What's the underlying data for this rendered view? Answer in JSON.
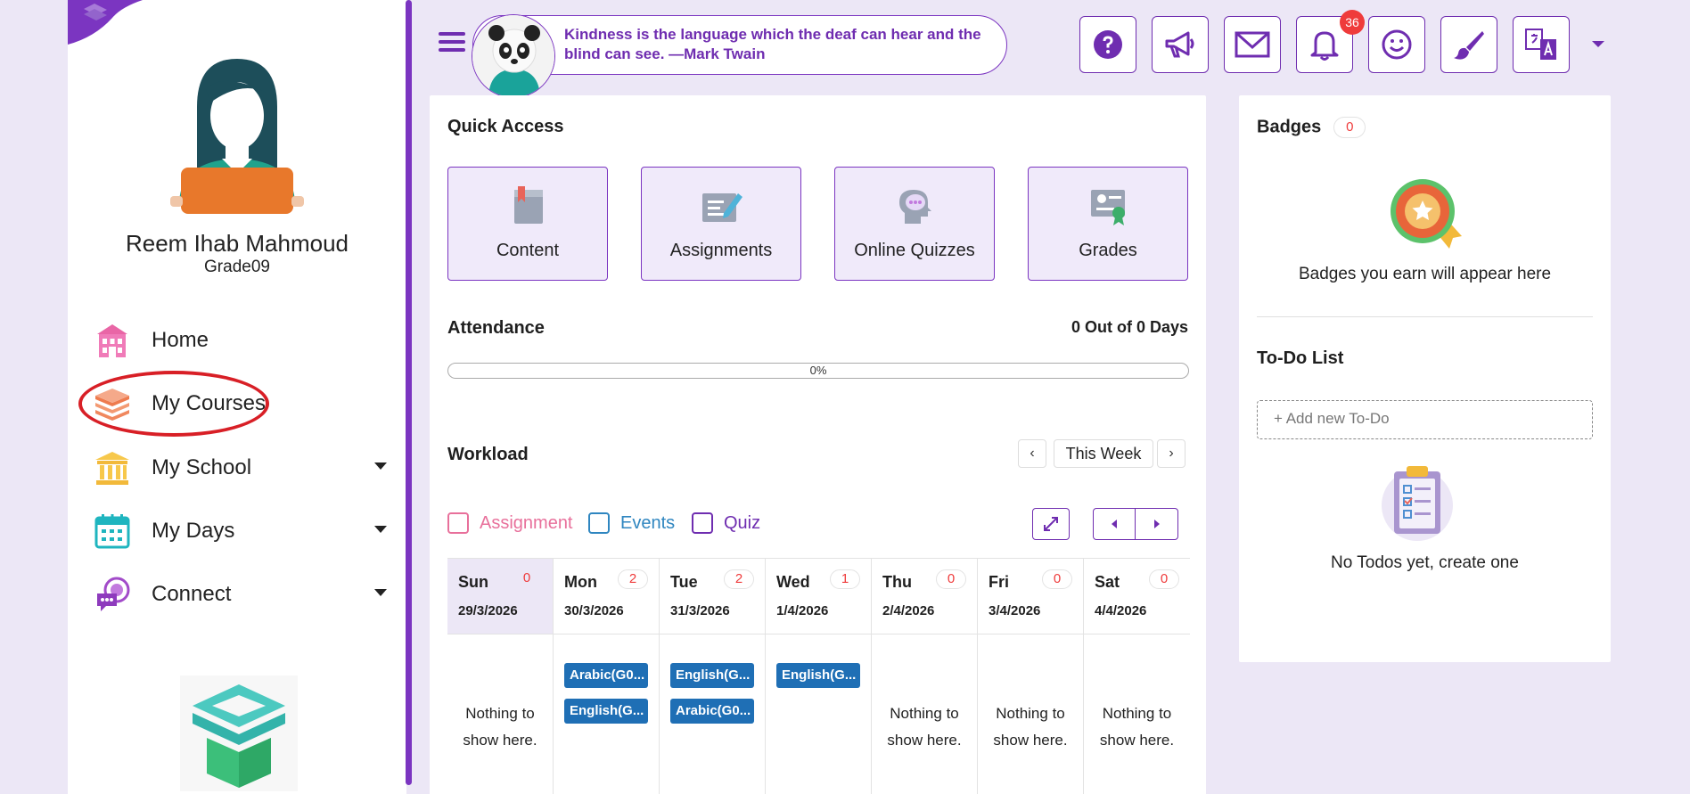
{
  "colors": {
    "primary": "#6f2db0",
    "badge_red": "#ef3b3b",
    "event_blue": "#1f6fb5",
    "legend_assignment": "#e8709b",
    "legend_events": "#2f86c0",
    "legend_quiz": "#6f2db0",
    "highlight": "#d81f26"
  },
  "user": {
    "name": "Reem Ihab Mahmoud",
    "grade": "Grade09"
  },
  "nav": [
    {
      "label": "Home",
      "icon": "school-building-icon",
      "has_dropdown": false
    },
    {
      "label": "My Courses",
      "icon": "books-icon",
      "has_dropdown": false,
      "highlighted": true
    },
    {
      "label": "My School",
      "icon": "institution-icon",
      "has_dropdown": true
    },
    {
      "label": "My Days",
      "icon": "calendar-icon",
      "has_dropdown": true
    },
    {
      "label": "Connect",
      "icon": "chat-bubbles-icon",
      "has_dropdown": true
    }
  ],
  "quote": {
    "text": "Kindness is the language which the deaf can hear and the blind can see. —Mark Twain"
  },
  "toolbar": {
    "buttons": [
      "help-icon",
      "megaphone-icon",
      "mail-icon",
      "bell-icon",
      "smiley-icon",
      "brush-icon",
      "translate-icon"
    ],
    "notification_count": "36"
  },
  "quick_access": {
    "title": "Quick Access",
    "items": [
      {
        "label": "Content",
        "icon": "book-icon"
      },
      {
        "label": "Assignments",
        "icon": "assignment-pen-icon"
      },
      {
        "label": "Online Quizzes",
        "icon": "quiz-head-icon"
      },
      {
        "label": "Grades",
        "icon": "certificate-icon"
      }
    ]
  },
  "attendance": {
    "title": "Attendance",
    "summary": "0 Out of 0 Days",
    "progress_percent": 0,
    "progress_text": "0%"
  },
  "workload": {
    "title": "Workload",
    "week_label": "This Week",
    "legend": [
      "Assignment",
      "Events",
      "Quiz"
    ],
    "days": [
      {
        "name": "Sun",
        "count": "0",
        "date": "29/3/2026",
        "events": [],
        "empty_line1": "Nothing to",
        "empty_line2": "show here."
      },
      {
        "name": "Mon",
        "count": "2",
        "date": "30/3/2026",
        "events": [
          "Arabic(G0...",
          "English(G..."
        ]
      },
      {
        "name": "Tue",
        "count": "2",
        "date": "31/3/2026",
        "events": [
          "English(G...",
          "Arabic(G0..."
        ]
      },
      {
        "name": "Wed",
        "count": "1",
        "date": "1/4/2026",
        "events": [
          "English(G..."
        ]
      },
      {
        "name": "Thu",
        "count": "0",
        "date": "2/4/2026",
        "events": [],
        "empty_line1": "Nothing to",
        "empty_line2": "show here."
      },
      {
        "name": "Fri",
        "count": "0",
        "date": "3/4/2026",
        "events": [],
        "empty_line1": "Nothing to",
        "empty_line2": "show here."
      },
      {
        "name": "Sat",
        "count": "0",
        "date": "4/4/2026",
        "events": [],
        "empty_line1": "Nothing to",
        "empty_line2": "show here."
      }
    ]
  },
  "badges": {
    "title": "Badges",
    "count": "0",
    "empty_text": "Badges you earn will appear here"
  },
  "todo": {
    "title": "To-Do List",
    "placeholder": "+ Add new To-Do",
    "empty_text": "No Todos yet, create one"
  }
}
